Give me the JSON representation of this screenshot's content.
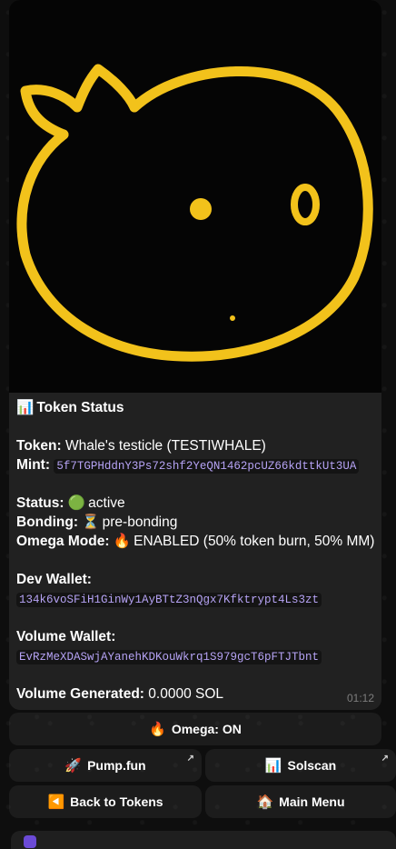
{
  "message": {
    "header": {
      "icon": "📊",
      "text": "Token Status"
    },
    "token": {
      "label": "Token:",
      "value": "Whale's testicle (TESTIWHALE)"
    },
    "mint": {
      "label": "Mint:",
      "value": "5f7TGPHddnY3Ps72shf2YeQN1462pcUZ66kdttkUt3UA"
    },
    "status": {
      "label": "Status:",
      "icon": "🟢",
      "value": "active"
    },
    "bonding": {
      "label": "Bonding:",
      "icon": "⏳",
      "value": "pre-bonding"
    },
    "omega_mode": {
      "label": "Omega Mode:",
      "icon": "🔥",
      "value": "ENABLED (50% token burn, 50% MM)"
    },
    "dev_wallet": {
      "label": "Dev Wallet:",
      "value": "134k6voSFiH1GinWy1AyBTtZ3nQgx7Kfktrypt4Ls3zt"
    },
    "volume_wallet": {
      "label": "Volume Wallet:",
      "value": "EvRzMeXDASwjAYanehKDKouWkrq1S979gcT6pFTJTbnt"
    },
    "volume_generated": {
      "label": "Volume Generated:",
      "value": "0.0000 SOL"
    },
    "time": "01:12"
  },
  "buttons": {
    "omega": {
      "icon": "🔥",
      "label": "Omega: ON"
    },
    "pump": {
      "icon": "🚀",
      "label": "Pump.fun"
    },
    "solscan": {
      "icon": "📊",
      "label": "Solscan"
    },
    "back": {
      "icon": "◀️",
      "label": "Back to Tokens"
    },
    "main_menu": {
      "icon": "🏠",
      "label": "Main Menu"
    },
    "external_arrow": "↗"
  },
  "colors": {
    "bubble": "#212121",
    "code_text": "#b6a3f5",
    "whale_stroke": "#f2c21b",
    "background": "#0e0e0e"
  },
  "icons": {
    "photo": "whale-drawing-image"
  }
}
